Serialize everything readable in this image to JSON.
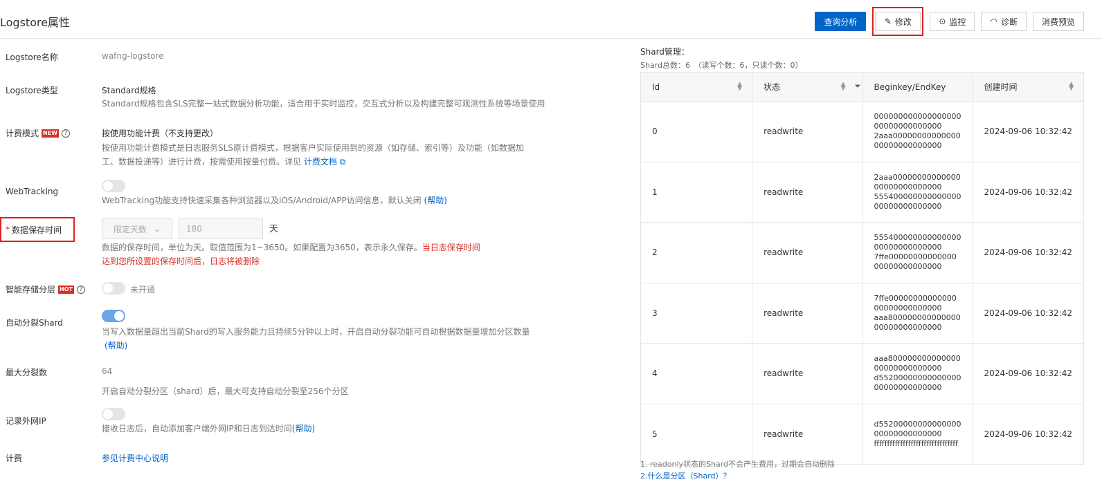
{
  "header": {
    "title": "Logstore属性",
    "buttons": {
      "query": "查询分析",
      "edit": "修改",
      "monitor": "监控",
      "diagnose": "诊断",
      "consume": "消费预览"
    }
  },
  "form": {
    "name": {
      "label": "Logstore名称",
      "value": "wafng-logstore"
    },
    "type": {
      "label": "Logstore类型",
      "value": "Standard规格",
      "desc": "Standard规格包含SLS完整一站式数据分析功能，适合用于实时监控，交互式分析以及构建完整可观测性系统等场景使用"
    },
    "billing_mode": {
      "label": "计费模式",
      "badge": "NEW",
      "value": "按使用功能计费（不支持更改）",
      "desc_line1": "按使用功能计费模式是日志服务SLS原计费模式，根据客户实际使用到的资源（如存储、索引等）及功能（如数据加",
      "desc_line2": "工、数据投递等）进行计费，按需使用按量付费。详见",
      "doc_link": "计费文档"
    },
    "webtracking": {
      "label": "WebTracking",
      "enabled": false,
      "desc": "WebTracking功能支持快速采集各种浏览器以及iOS/Android/APP访问信息，默认关闭",
      "help": "(帮助)"
    },
    "retention": {
      "required_mark": "*",
      "label": "数据保存时间",
      "select_value": "限定天数",
      "input_value": "180",
      "unit": "天",
      "desc": "数据的保存时间，单位为天。取值范围为1~3650。如果配置为3650，表示永久保存。",
      "warn_line1": "当日志保存时间",
      "warn_line2": "达到您所设置的保存时间后，日志将被删除"
    },
    "tiered_storage": {
      "label": "智能存储分层",
      "badge": "HOT",
      "enabled": false,
      "status": "未开通"
    },
    "auto_split": {
      "label": "自动分裂Shard",
      "enabled": true,
      "desc": "当写入数据量超出当前Shard的写入服务能力且持续5分钟以上时，开启自动分裂功能可自动根据数据量增加分区数量",
      "help": "(帮助)"
    },
    "max_split": {
      "label": "最大分裂数",
      "value": "64",
      "desc": "开启自动分裂分区（shard）后，最大可支持自动分裂至256个分区"
    },
    "public_ip": {
      "label": "记录外网IP",
      "enabled": false,
      "desc": "接收日志后，自动添加客户端外网IP和日志到达时间",
      "help": "(帮助)"
    },
    "billing": {
      "label": "计费",
      "link": "参见计费中心说明"
    }
  },
  "shards": {
    "title": "Shard管理：",
    "summary": "Shard总数：6　（读写个数：6，只读个数：0）",
    "columns": [
      "Id",
      "状态",
      "Beginkey/EndKey",
      "创建时间"
    ],
    "rows": [
      {
        "id": "0",
        "status": "readwrite",
        "begin": "00000000000000000000000000000000",
        "end": "2aaa0000000000000000000000000000",
        "created": "2024-09-06 10:32:42"
      },
      {
        "id": "1",
        "status": "readwrite",
        "begin": "2aaa0000000000000000000000000000",
        "end": "55540000000000000000000000000000",
        "created": "2024-09-06 10:32:42"
      },
      {
        "id": "2",
        "status": "readwrite",
        "begin": "55540000000000000000000000000000",
        "end": "7ffe0000000000000000000000000000",
        "created": "2024-09-06 10:32:42"
      },
      {
        "id": "3",
        "status": "readwrite",
        "begin": "7ffe0000000000000000000000000000",
        "end": "aaa80000000000000000000000000000",
        "created": "2024-09-06 10:32:42"
      },
      {
        "id": "4",
        "status": "readwrite",
        "begin": "aaa80000000000000000000000000000",
        "end": "d5520000000000000000000000000000",
        "created": "2024-09-06 10:32:42"
      },
      {
        "id": "5",
        "status": "readwrite",
        "begin": "d5520000000000000000000000000000",
        "end": "ffffffffffffffffffffffffffffffff",
        "created": "2024-09-06 10:32:42"
      }
    ],
    "note1": "1. readonly状态的Shard不会产生费用，过期会自动删除",
    "note2": "2.什么是分区（Shard）？"
  }
}
